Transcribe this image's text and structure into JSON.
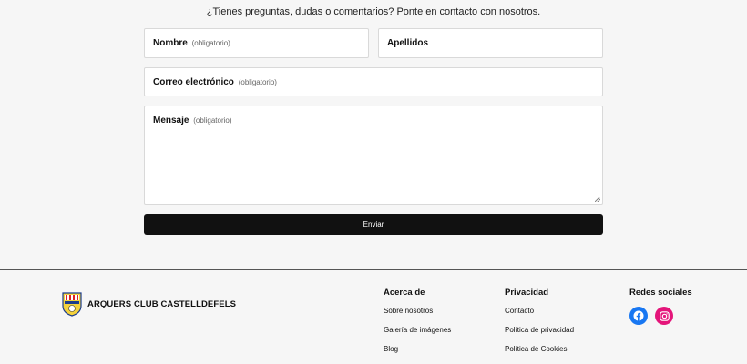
{
  "contact": {
    "intro": "¿Tienes preguntas, dudas o comentarios? Ponte en contacto con nosotros.",
    "fields": {
      "nombre": {
        "label": "Nombre",
        "hint": "(obligatorio)"
      },
      "apellidos": {
        "label": "Apellidos"
      },
      "email": {
        "label": "Correo electrónico",
        "hint": "(obligatorio)"
      },
      "mensaje": {
        "label": "Mensaje",
        "hint": "(obligatorio)"
      }
    },
    "submit_label": "Enviar"
  },
  "footer": {
    "brand_name": "ARQUERS CLUB CASTELLDEFELS",
    "about": {
      "heading": "Acerca de",
      "links": [
        "Sobre nosotros",
        "Galería de imágenes",
        "Blog"
      ]
    },
    "privacy": {
      "heading": "Privacidad",
      "links": [
        "Contacto",
        "Política de privacidad",
        "Política de Cookies"
      ]
    },
    "social": {
      "heading": "Redes sociales",
      "icons": [
        "facebook-icon",
        "instagram-icon"
      ]
    }
  },
  "colors": {
    "facebook": "#1877f2",
    "instagram": "#e4157a",
    "button": "#111111"
  }
}
